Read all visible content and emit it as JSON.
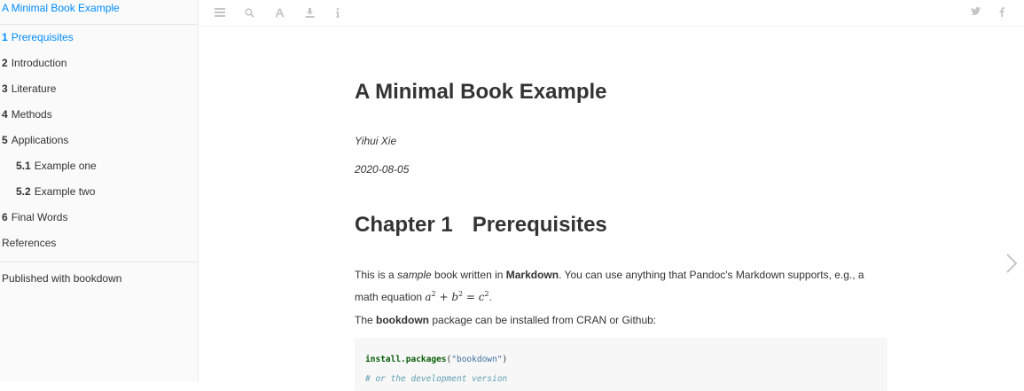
{
  "sidebar": {
    "title": "A Minimal Book Example",
    "items": [
      {
        "num": "1",
        "label": "Prerequisites"
      },
      {
        "num": "2",
        "label": "Introduction"
      },
      {
        "num": "3",
        "label": "Literature"
      },
      {
        "num": "4",
        "label": "Methods"
      },
      {
        "num": "5",
        "label": "Applications"
      },
      {
        "num": "5.1",
        "label": "Example one"
      },
      {
        "num": "5.2",
        "label": "Example two"
      },
      {
        "num": "6",
        "label": "Final Words"
      },
      {
        "num": "",
        "label": "References"
      }
    ],
    "footer": "Published with bookdown"
  },
  "toolbar": {
    "icons": [
      "menu-icon",
      "search-icon",
      "font-settings-icon",
      "download-icon",
      "info-icon"
    ],
    "social": [
      "twitter-icon",
      "facebook-icon"
    ]
  },
  "main": {
    "title": "A Minimal Book Example",
    "author": "Yihui Xie",
    "date": "2020-08-05",
    "chapter": {
      "prefix": "Chapter 1",
      "title": "Prerequisites"
    },
    "para1": {
      "t1": "This is a ",
      "t2": "sample",
      "t3": " book written in ",
      "t4": "Markdown",
      "t5": ". You can use anything that Pandoc's Markdown supports, e.g., a math equation ",
      "t6": "."
    },
    "para2": {
      "t1": "The ",
      "t2": "bookdown",
      "t3": " package can be installed from CRAN or Github:"
    },
    "code": {
      "line1_fn": "install.packages",
      "line1_open": "(",
      "line1_str": "\"bookdown\"",
      "line1_close": ")",
      "line2_comment": "# or the development version"
    }
  },
  "colors": {
    "accent": "#008cff",
    "icon": "#c5c5c5",
    "sidebar_bg": "#fafafa",
    "code_bg": "#f7f7f7"
  }
}
